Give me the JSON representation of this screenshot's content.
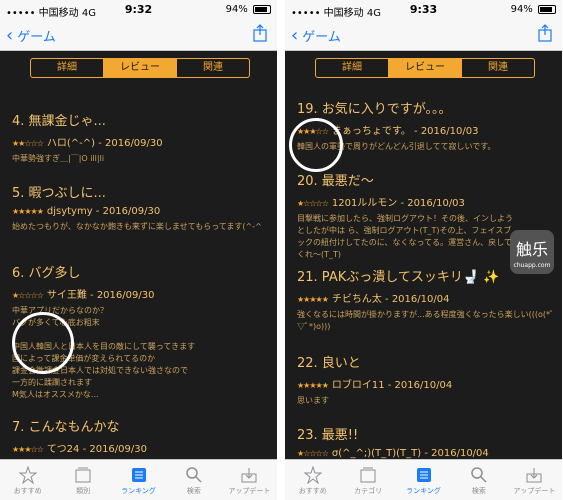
{
  "status": {
    "carrier": "••••• 中国移动  4G",
    "battery": "94%"
  },
  "left": {
    "time": "9:32",
    "back_label": "ゲーム",
    "segments": [
      "詳細",
      "レビュー",
      "関連"
    ],
    "reviews": [
      {
        "title": "4. 無課金じゃ...",
        "stars": "★★☆☆☆",
        "meta": "ハロ(^-^) - 2016/09/30",
        "body": "中華勢強すぎ＿|￣|O ill|li"
      },
      {
        "title": "5. 暇つぶしに...",
        "stars": "★★★★★",
        "meta": "djsytymy - 2016/09/30",
        "body": "始めたつもりが、なかなか飽きも来ずに楽しませてもらってます(^-^"
      },
      {
        "title": "6. バグ多し",
        "stars": "★☆☆☆☆",
        "meta": "サイ王難 - 2016/09/30",
        "body": "中華アプリだからなのか？\nバグが多くて心底お粗末\n\n中国人韓国人と日本人を目の敵にして襲ってきます\n国によって課金単価が変えられてるのか\n課金会微課金日本人では対処できない強さなので\n一方的に蹂躙されます\nM気人はオススメかな..."
      },
      {
        "title": "7. こんなもんかな",
        "stars": "★★★☆☆",
        "meta": "てつ24 - 2016/09/30",
        "body": ""
      }
    ]
  },
  "right": {
    "time": "9:33",
    "back_label": "ゲーム",
    "segments": [
      "詳細",
      "レビュー",
      "関連"
    ],
    "reviews": [
      {
        "title": "19. お気に入りですが。。。",
        "stars": "★★★☆☆",
        "meta": "まぁっちょです。 - 2016/10/03",
        "body": "韓国人の軍勢で周りがどんどん引退してて寂しいです。"
      },
      {
        "title": "20. 最悪だ～",
        "stars": "★☆☆☆☆",
        "meta": "1201ルルモン - 2016/10/03",
        "body": "目撃戦に参加したら、強制ログアウト！その後、インしようとしたが中は ら、強制ログアウト(T_T)その上、フェイスブックの紐付けしてたのに、なくなってる。運営さん、戻してくれ〜(T_T)"
      },
      {
        "title": "21. PAKぶっ潰してスッキリ🚽 ✨",
        "stars": "★★★★★",
        "meta": "チビちん太 - 2016/10/04",
        "body": "強くなるには時間が掛かりますが...ある程度強くなったら楽しい(((o(*ﾟ▽ﾟ*)o)))"
      },
      {
        "title": "22. 良いと",
        "stars": "★★★★★",
        "meta": "ロブロイ11 - 2016/10/04",
        "body": "思います"
      },
      {
        "title": "23. 最悪!!",
        "stars": "★☆☆☆☆",
        "meta": "σ(^_^;)(T_T)(T_T) - 2016/10/04",
        "body": ""
      }
    ]
  },
  "tabs": [
    "おすすめ",
    "カテゴリ",
    "ランキング",
    "検索",
    "アップデート"
  ],
  "tabs_shown_left": [
    "おすすめ",
    "類別",
    "ランキング",
    "検索",
    "アップデート"
  ],
  "watermark": {
    "big": "触乐",
    "small": "chuapp.com"
  },
  "colors": {
    "accent": "#f3a832",
    "link": "#1a7bf2",
    "background": "#1c1c1c"
  }
}
